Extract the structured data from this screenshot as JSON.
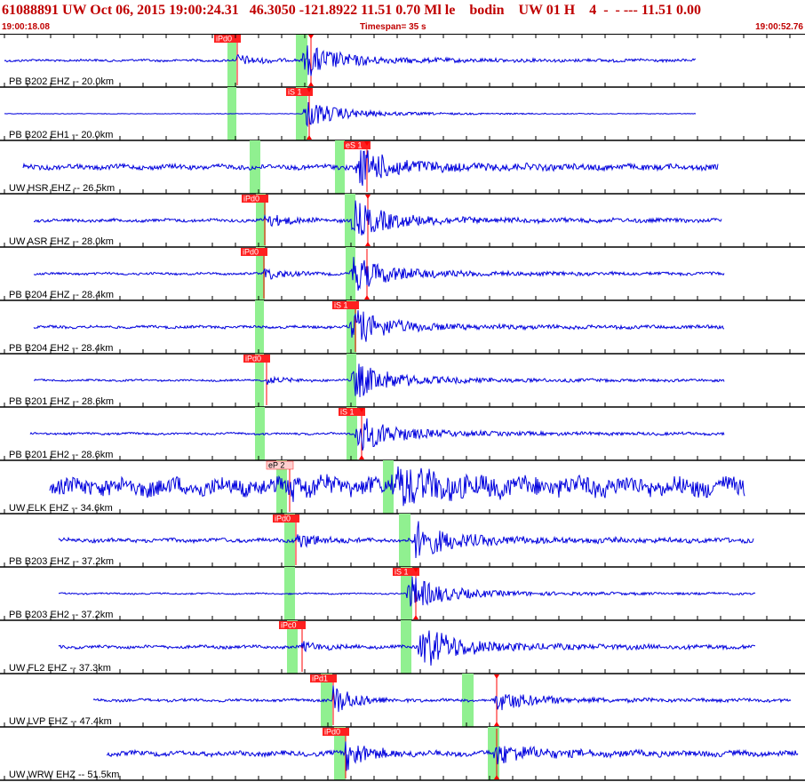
{
  "header": {
    "title": "61088891 UW Oct 06, 2015 19:00:24.31   46.3050 -121.8922 11.51 0.70 Ml le    bodin    UW 01 H    4  -  - --- 11.51 0.00",
    "start_time": "19:00:18.08",
    "timespan": "Timespan=  35 s",
    "end_time": "19:00:52.76"
  },
  "colors": {
    "trace": "#0000dd",
    "pick": "#ff0000",
    "pick_label_bg": "#ff2020",
    "theoretical_window": "#90f090",
    "axis": "#000000",
    "header_text": "#c00000"
  },
  "channels": [
    {
      "label": "PB B202 EHZ -- 20.0km",
      "pick": "iPd0",
      "pick_style": "red"
    },
    {
      "label": "PB B202 EH1 -- 20.0km",
      "pick": "iS 1",
      "pick_style": "red"
    },
    {
      "label": "UW HSR EHZ -- 26.5km",
      "pick": "eS 1",
      "pick_style": "red"
    },
    {
      "label": "UW ASR EHZ -- 28.0km",
      "pick": "iPd0",
      "pick_style": "red"
    },
    {
      "label": "PB B204 EHZ -- 28.4km",
      "pick": "iPd0",
      "pick_style": "red"
    },
    {
      "label": "PB B204 EH2 -- 28.4km",
      "pick": "iS 1",
      "pick_style": "red"
    },
    {
      "label": "PB B201 EHZ -- 28.6km",
      "pick": "iPd0",
      "pick_style": "red"
    },
    {
      "label": "PB B201 EH2 -- 28.6km",
      "pick": "iS 1",
      "pick_style": "red"
    },
    {
      "label": "UW ELK EHZ -- 34.6km",
      "pick": "eP 2",
      "pick_style": "light"
    },
    {
      "label": "PB B203 EHZ -- 37.2km",
      "pick": "iPd0",
      "pick_style": "red"
    },
    {
      "label": "PB B203 EH2 -- 37.2km",
      "pick": "iS 1",
      "pick_style": "red"
    },
    {
      "label": "UW FL2 EHZ -- 37.3km",
      "pick": "iPc0",
      "pick_style": "red"
    },
    {
      "label": "UW LVP EHZ -- 47.4km",
      "pick": "iPd1",
      "pick_style": "red"
    },
    {
      "label": "UW WRW EHZ -- 51.5km",
      "pick": "iPd0",
      "pick_style": "red"
    }
  ]
}
